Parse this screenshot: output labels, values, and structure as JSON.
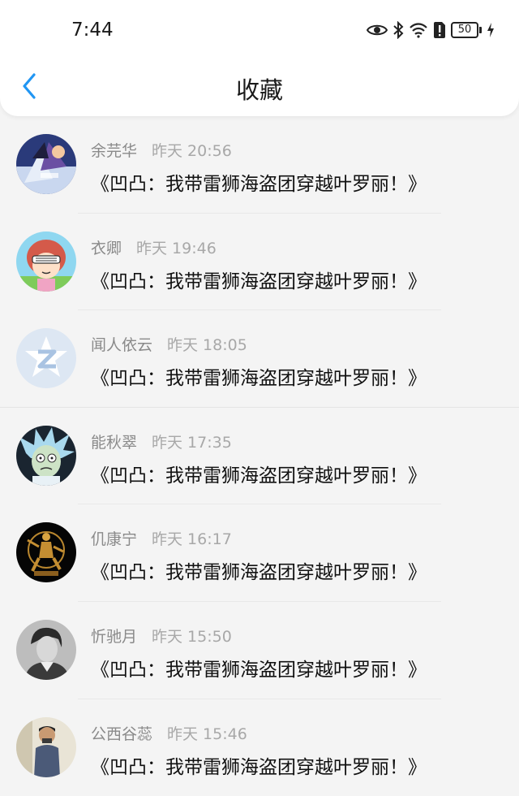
{
  "status_bar": {
    "time": "7:44",
    "battery": "50"
  },
  "header": {
    "title": "收藏"
  },
  "items": [
    {
      "name": "余芫华",
      "time": "昨天 20:56",
      "title": "《凹凸：我带雷狮海盗团穿越叶罗丽！》",
      "avatar": "anime-avatar"
    },
    {
      "name": "衣卿",
      "time": "昨天 19:46",
      "title": "《凹凸：我带雷狮海盗团穿越叶罗丽！》",
      "avatar": "cartoon-girl-avatar"
    },
    {
      "name": "闻人依云",
      "time": "昨天 18:05",
      "title": "《凹凸：我带雷狮海盗团穿越叶罗丽！》",
      "avatar": "default-z-avatar"
    },
    {
      "name": "能秋翠",
      "time": "昨天 17:35",
      "title": "《凹凸：我带雷狮海盗团穿越叶罗丽！》",
      "avatar": "rick-avatar"
    },
    {
      "name": "仉康宁",
      "time": "昨天 16:17",
      "title": "《凹凸：我带雷狮海盗团穿越叶罗丽！》",
      "avatar": "statue-avatar"
    },
    {
      "name": "忻驰月",
      "time": "昨天 15:50",
      "title": "《凹凸：我带雷狮海盗团穿越叶罗丽！》",
      "avatar": "portrait-avatar"
    },
    {
      "name": "公西谷蕊",
      "time": "昨天 15:46",
      "title": "《凹凸：我带雷狮海盗团穿越叶罗丽！》",
      "avatar": "person-avatar"
    }
  ],
  "colors": {
    "accent": "#2196f3",
    "background": "#f4f4f4",
    "name_gray": "#8a8a8a"
  }
}
